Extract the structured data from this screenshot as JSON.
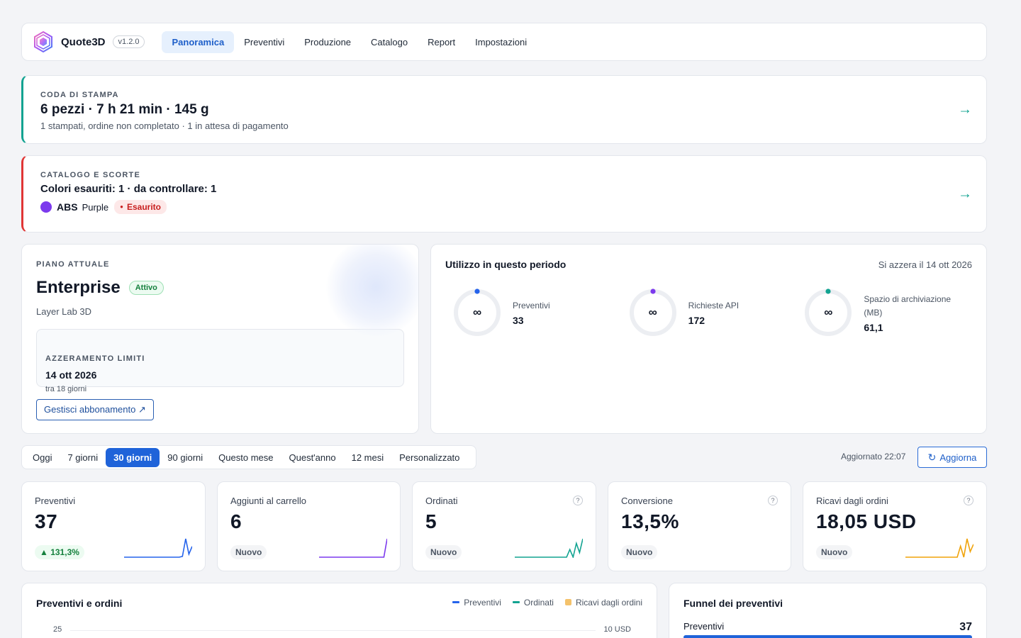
{
  "app": {
    "name": "Quote3D",
    "version": "v1.2.0"
  },
  "nav": [
    "Panoramica",
    "Preventivi",
    "Produzione",
    "Catalogo",
    "Report",
    "Impostazioni"
  ],
  "nav_active": "Panoramica",
  "queue": {
    "eyebrow": "CODA DI STAMPA",
    "headline": "6 pezzi · 7 h 21 min · 145 g",
    "sub": "1 stampati, ordine non completato · 1 in attesa di pagamento",
    "accent": "#12a391"
  },
  "stock": {
    "eyebrow": "CATALOGO E SCORTE",
    "headline": "Colori esauriti: 1 · da controllare: 1",
    "material": "ABS",
    "color_name": "Purple",
    "status": "Esaurito",
    "accent": "#e03636",
    "swatch": "#7c3aed"
  },
  "plan": {
    "eyebrow": "PIANO ATTUALE",
    "name": "Enterprise",
    "status": "Attivo",
    "org": "Layer Lab 3D",
    "reset_eyebrow": "AZZERAMENTO LIMITI",
    "reset_date": "14 ott 2026",
    "reset_in": "tra 18 giorni",
    "manage_label": "Gestisci abbonamento ↗"
  },
  "usage": {
    "title": "Utilizzo in questo periodo",
    "reset_note": "Si azzera il 14 ott 2026",
    "meters": [
      {
        "label": "Preventivi",
        "value": "33",
        "limit": "∞",
        "color": "#2563eb"
      },
      {
        "label": "Richieste API",
        "value": "172",
        "limit": "∞",
        "color": "#7c3aed"
      },
      {
        "label": "Spazio di archiviazione (MB)",
        "value": "61,1",
        "limit": "∞",
        "color": "#12a391"
      }
    ]
  },
  "periods": [
    "Oggi",
    "7 giorni",
    "30 giorni",
    "90 giorni",
    "Questo mese",
    "Quest'anno",
    "12 mesi",
    "Personalizzato"
  ],
  "period_active": "30 giorni",
  "updated": "Aggiornato 22:07",
  "refresh_label": "Aggiorna",
  "kpis": [
    {
      "label": "Preventivi",
      "value": "37",
      "badge": "▲ 131,3%",
      "badge_type": "up",
      "help": false,
      "color": "#2563eb",
      "spark": [
        0,
        0,
        0,
        0,
        0,
        0,
        0,
        0,
        0,
        0,
        0,
        0,
        0,
        0,
        0,
        0,
        0,
        0,
        1,
        24,
        4,
        14
      ]
    },
    {
      "label": "Aggiunti al carrello",
      "value": "6",
      "badge": "Nuovo",
      "badge_type": "new",
      "help": false,
      "color": "#7c3aed",
      "spark": [
        0,
        0,
        0,
        0,
        0,
        0,
        0,
        0,
        0,
        0,
        0,
        0,
        0,
        0,
        0,
        0,
        0,
        0,
        0,
        0,
        0,
        24
      ]
    },
    {
      "label": "Ordinati",
      "value": "5",
      "badge": "Nuovo",
      "badge_type": "new",
      "help": true,
      "color": "#12a391",
      "spark": [
        0,
        0,
        0,
        0,
        0,
        0,
        0,
        0,
        0,
        0,
        0,
        0,
        0,
        0,
        0,
        0,
        0,
        10,
        0,
        18,
        6,
        24
      ]
    },
    {
      "label": "Conversione",
      "value": "13,5%",
      "badge": "Nuovo",
      "badge_type": "new",
      "help": true,
      "color": null,
      "spark": null
    },
    {
      "label": "Ricavi dagli ordini",
      "value": "18,05 USD",
      "badge": "Nuovo",
      "badge_type": "new",
      "help": true,
      "color": "#f0a30a",
      "spark": [
        0,
        0,
        0,
        0,
        0,
        0,
        0,
        0,
        0,
        0,
        0,
        0,
        0,
        0,
        0,
        0,
        0,
        12,
        0,
        20,
        6,
        14
      ]
    }
  ],
  "chart": {
    "title": "Preventivi e ordini",
    "legend": [
      {
        "name": "Preventivi",
        "color": "#2563eb",
        "shape": "line"
      },
      {
        "name": "Ordinati",
        "color": "#12a391",
        "shape": "line"
      },
      {
        "name": "Ricavi dagli ordini",
        "color": "#f4c26b",
        "shape": "square"
      }
    ],
    "y_left_top": "25",
    "y_right_top": "10 USD"
  },
  "funnel": {
    "title": "Funnel dei preventivi",
    "first_label": "Preventivi",
    "first_value": "37",
    "bar_color": "#1f63d9"
  }
}
